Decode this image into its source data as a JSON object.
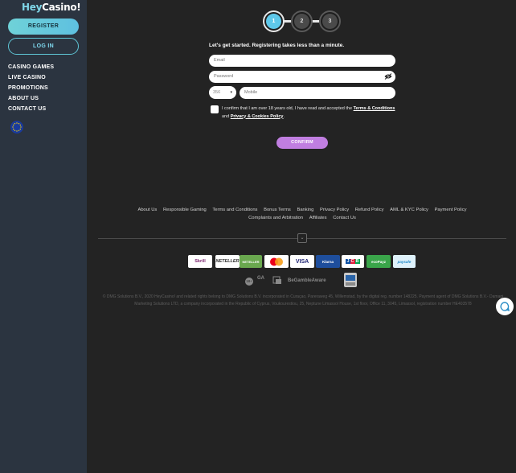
{
  "brand": {
    "logo_part1": "Hey",
    "logo_part2": "Casino!"
  },
  "sidebar": {
    "register_label": "REGISTER",
    "login_label": "LOG IN",
    "nav": [
      "CASINO GAMES",
      "LIVE CASINO",
      "PROMOTIONS",
      "ABOUT US",
      "CONTACT US"
    ]
  },
  "steps": [
    "1",
    "2",
    "3"
  ],
  "form": {
    "title": "Let's get started. Registering takes less than a minute.",
    "email_placeholder": "Email",
    "password_placeholder": "Password",
    "country_code": "356",
    "mobile_placeholder": "Mobile",
    "consent_prefix": "I confirm that I am over 18 years old, I have read and accepted the ",
    "terms_link": "Terms & Conditions",
    "consent_and": " and ",
    "privacy_link": "Privacy & Cookies Policy",
    "consent_suffix": ".",
    "confirm_label": "CONFIRM"
  },
  "footer": {
    "links": [
      "About Us",
      "Responsible Gaming",
      "Terms and Conditions",
      "Bonus Terms",
      "Banking",
      "Privacy Policy",
      "Refund Policy",
      "AML & KYC Policy",
      "Payment Policy",
      "Complaints and Arbitration",
      "Affiliates",
      "Contact Us"
    ],
    "payments": [
      "Skrill",
      "NETELLER",
      "NETELLER",
      "mastercard",
      "VISA",
      "Klarna",
      "JCB",
      "ecoPayz",
      "paysafe"
    ],
    "rg_badges": [
      "18+",
      "GA",
      "BeGambleAware"
    ],
    "legal_text": "© DMG Solutions B.V., 2020 HeyCasino! and related rights belong to DMG Solutions B.V. incorporated in Curaçao, Pareraweg 45, Willemstad, by the digital reg. number 148225. Payment agent of DMG Solutions B.V.- Damagi Marketing Solutions LTD, a company incorporated in the Republic of Cyprus, Voukourestiou, 25, Neptune Limassol House, 1st floor, Office 11, 3045, Limassol, registration number HE403578"
  },
  "colors": {
    "sidebar": "#2b3440",
    "accent": "#5ec8ea",
    "confirm": "#c07ee0",
    "background": "#232323"
  }
}
